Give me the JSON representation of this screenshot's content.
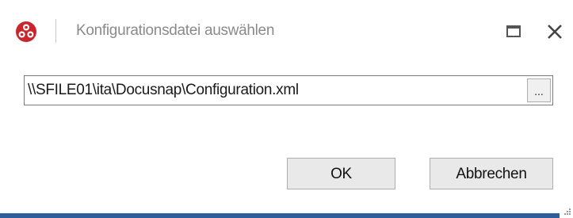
{
  "window": {
    "title": "Konfigurationsdatei auswählen",
    "accent_color": "#2d5d9a",
    "app_icon": "docusnap-logo-icon",
    "maximize_icon": "maximize-icon",
    "close_icon": "close-icon"
  },
  "path_field": {
    "value": "\\\\SFILE01\\ita\\Docusnap\\Configuration.xml",
    "browse_label": "..."
  },
  "buttons": {
    "ok_label": "OK",
    "cancel_label": "Abbrechen"
  }
}
